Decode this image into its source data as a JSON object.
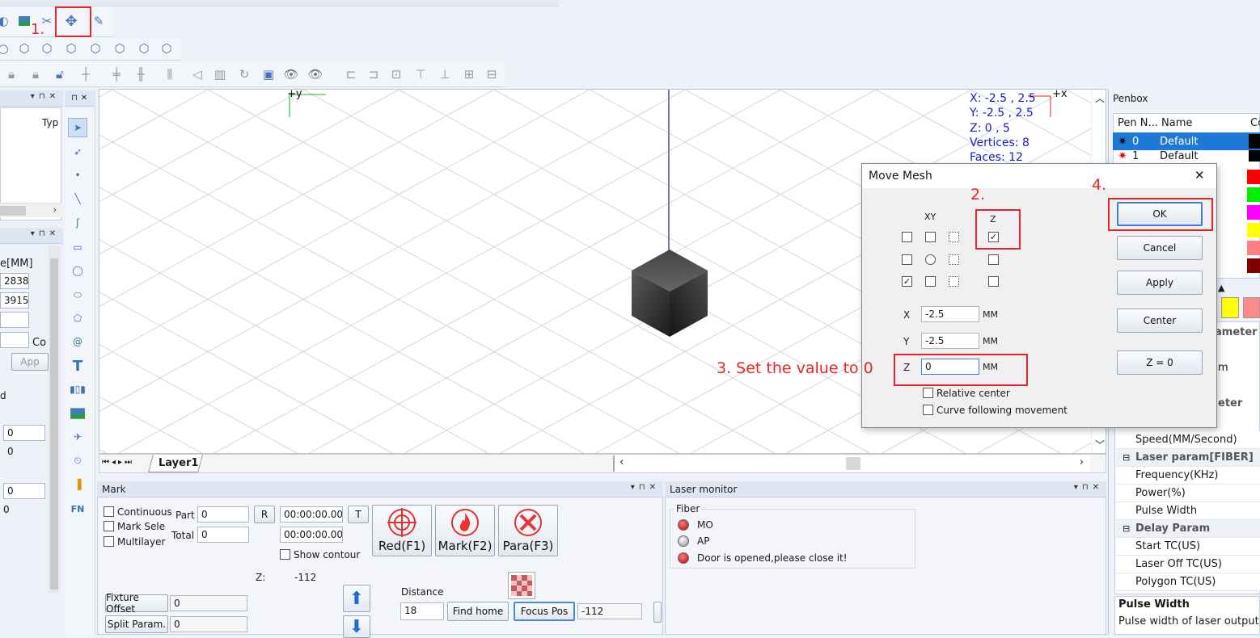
{
  "toolbar": {
    "annot1": "1.",
    "annot2": "2.",
    "annot3": "3. Set the value to 0",
    "annot4": "4."
  },
  "left_panel": {
    "type_col": "Typ",
    "size_label": "e[MM]",
    "val_a": "2838",
    "val_b": "3915",
    "co_label": "Co",
    "app_label": "App",
    "d_label": "d",
    "num_a": "0",
    "zero_a": "0",
    "num_b": "0",
    "zero_b": "0"
  },
  "canvas": {
    "axis_y": "+y",
    "axis_x": "+x",
    "info_x": "X: -2.5 , 2.5",
    "info_y": "Y: -2.5 , 2.5",
    "info_z": "Z: 0 , 5",
    "info_vertices": "Vertices: 8",
    "info_faces": "Faces: 12",
    "layer_tab": "Layer1"
  },
  "dialog": {
    "title": "Move Mesh",
    "close": "✕",
    "xy_label": "XY",
    "z_label": "Z",
    "x_label": "X",
    "x_value": "-2.5",
    "x_unit": "MM",
    "y_label": "Y",
    "y_value": "-2.5",
    "y_unit": "MM",
    "zf_label": "Z",
    "z_value": "0",
    "z_unit": "MM",
    "relative_center": "Relative center",
    "curve_following": "Curve following movement",
    "ok": "OK",
    "cancel": "Cancel",
    "apply": "Apply",
    "center": "Center",
    "z0": "Z = 0"
  },
  "penbox": {
    "title": "Penbox",
    "col_pen": "Pen N...",
    "col_name": "Name",
    "col_color": "Co",
    "rows": [
      {
        "num": "0",
        "name": "Default",
        "color": "#000000"
      },
      {
        "num": "1",
        "name": "Default",
        "color": "#000000"
      }
    ],
    "swatches": [
      "#ff0000",
      "#00ee00",
      "#ff00ff",
      "#ffff00",
      "#ff8080",
      "#800000"
    ],
    "extra_swatches": [
      "#ffff00",
      "#ff8080"
    ]
  },
  "properties": {
    "parameter_hdr": "ameter",
    "m_label": "m",
    "eter_hdr": "eter",
    "speed": "Speed(MM/Second)",
    "laser_param": "Laser param[FIBER]",
    "frequency": "Frequency(KHz)",
    "power": "Power(%)",
    "pulse_width": "Pulse Width",
    "delay_param": "Delay Param",
    "start_tc": "Start TC(US)",
    "laser_off_tc": "Laser Off TC(US)",
    "polygon_tc": "Polygon TC(US)",
    "desc_title": "Pulse Width",
    "desc_text": "Pulse width of laser output"
  },
  "mark": {
    "title": "Mark",
    "continuous": "Continuous",
    "mark_select": "Mark Select",
    "multilayer": "Multilayer",
    "part_label": "Part",
    "part_value": "0",
    "total_label": "Total",
    "total_value": "0",
    "r_btn": "R",
    "t_btn": "T",
    "time1": "00:00:00.000",
    "time2": "00:00:00.000",
    "show_contour": "Show contour",
    "red_btn": "Red(F1)",
    "mark_btn": "Mark(F2)",
    "para_btn": "Para(F3)",
    "z_label": "Z:",
    "z_value": "-112",
    "fixture_offset": "Fixture Offset",
    "fixture_value": "0",
    "split_param": "Split Param.",
    "split_value": "0",
    "distance_label": "Distance",
    "distance_value": "18",
    "find_home": "Find home",
    "focus_pos": "Focus Pos",
    "focus_value": "-112"
  },
  "laser_monitor": {
    "title": "Laser monitor",
    "group": "Fiber",
    "mo": "MO",
    "ap": "AP",
    "door": "Door is opened,please close it!"
  }
}
